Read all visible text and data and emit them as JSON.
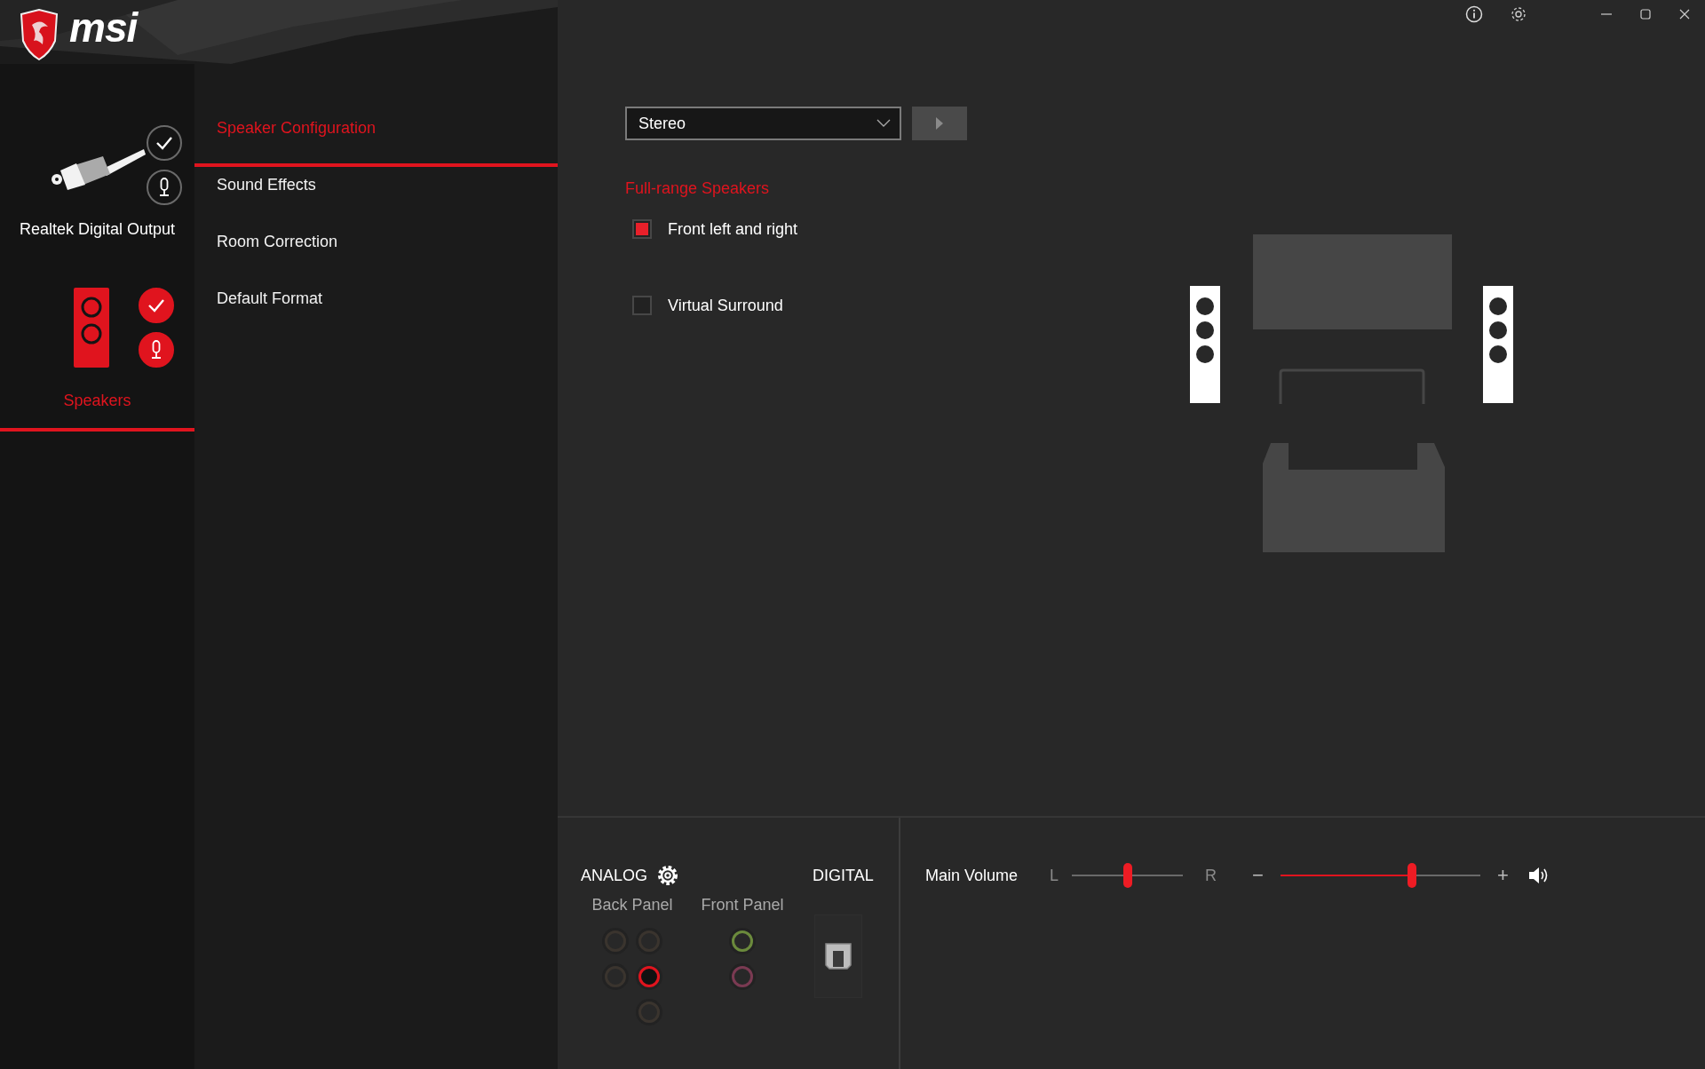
{
  "window": {
    "brand": "msi"
  },
  "devices": [
    {
      "name": "Realtek Digital Output",
      "kind": "optical",
      "selected": false
    },
    {
      "name": "Speakers",
      "kind": "speaker",
      "selected": true
    }
  ],
  "nav": [
    {
      "label": "Speaker Configuration",
      "selected": true
    },
    {
      "label": "Sound Effects",
      "selected": false
    },
    {
      "label": "Room Correction",
      "selected": false
    },
    {
      "label": "Default Format",
      "selected": false
    }
  ],
  "config": {
    "mode": {
      "value": "Stereo"
    },
    "section_label": "Full-range Speakers",
    "options": [
      {
        "label": "Front left and right",
        "checked": true
      },
      {
        "label": "Virtual Surround",
        "checked": false
      }
    ]
  },
  "connectors": {
    "analog": {
      "title": "ANALOG",
      "back_panel": {
        "label": "Back Panel",
        "jacks": [
          {
            "color": "#3a342e",
            "active": false
          },
          {
            "color": "#3a342e",
            "active": false
          },
          {
            "color": "#3a342e",
            "active": false
          },
          {
            "color": "#e0141e",
            "active": true
          },
          {
            "color": "#3a342e",
            "active": false
          }
        ]
      },
      "front_panel": {
        "label": "Front Panel",
        "jacks": [
          {
            "color": "#6b8a3c",
            "active": false
          },
          {
            "color": "#7a3a52",
            "active": false
          }
        ]
      }
    },
    "digital": {
      "title": "DIGITAL"
    }
  },
  "volume": {
    "label": "Main Volume",
    "balance": {
      "left": "L",
      "right": "R",
      "level": 0.5
    },
    "main": {
      "minus": "−",
      "plus": "+",
      "level": 0.66
    }
  }
}
